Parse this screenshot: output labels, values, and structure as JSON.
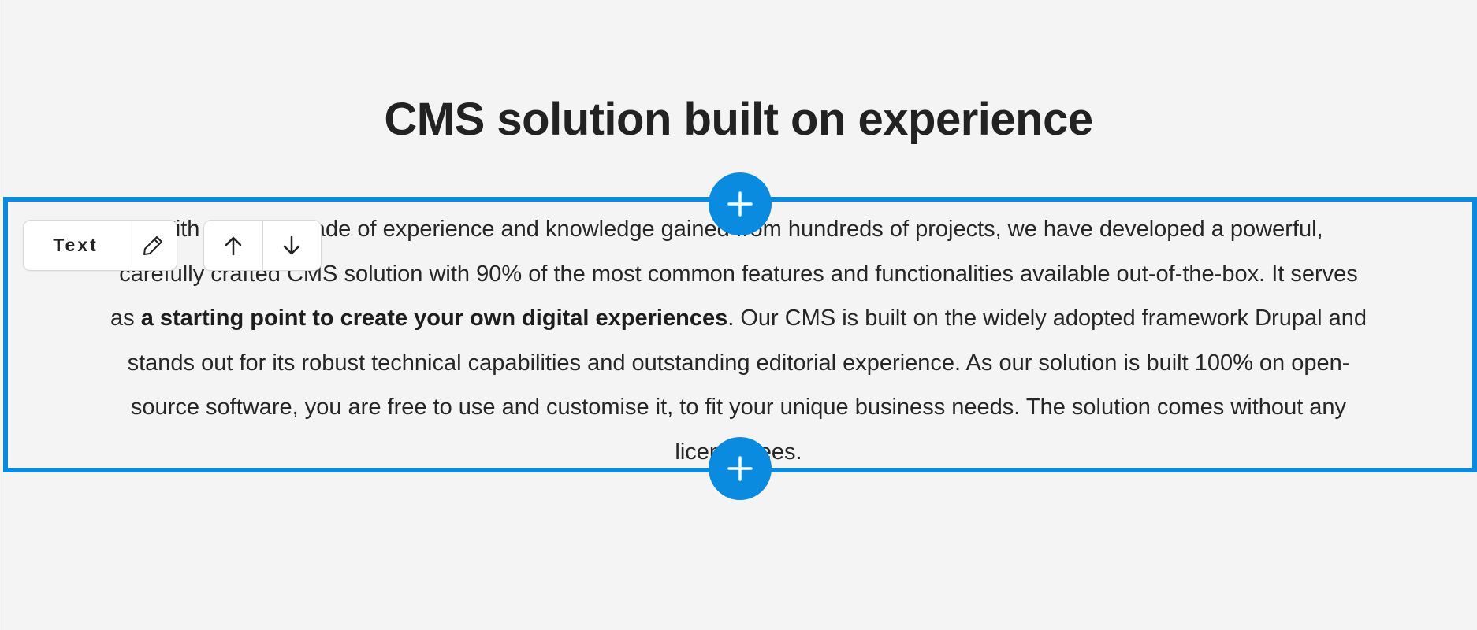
{
  "section": {
    "heading": "CMS solution built on experience",
    "paragraph": {
      "before_bold": "With over a decade of experience and knowledge gained from hundreds of projects, we have developed a powerful, carefully crafted CMS solution with 90% of the most common features and functionalities available out-of-the-box. It serves as ",
      "bold": "a starting point to create your own digital experiences",
      "after_bold": ". Our CMS is built on the widely adopted framework Drupal and stands out for its robust technical capabilities and outstanding editorial experience. As our solution is built 100% on open-source software, you are free to use and customise it, to fit your unique business needs. The solution comes without any licence fees."
    }
  },
  "editor": {
    "block_type_label": "Text",
    "edit_icon": "pencil-icon",
    "move_up_icon": "arrow-up-icon",
    "move_down_icon": "arrow-down-icon",
    "add_block_icon": "plus-icon",
    "accent_color": "#0b8be0"
  }
}
